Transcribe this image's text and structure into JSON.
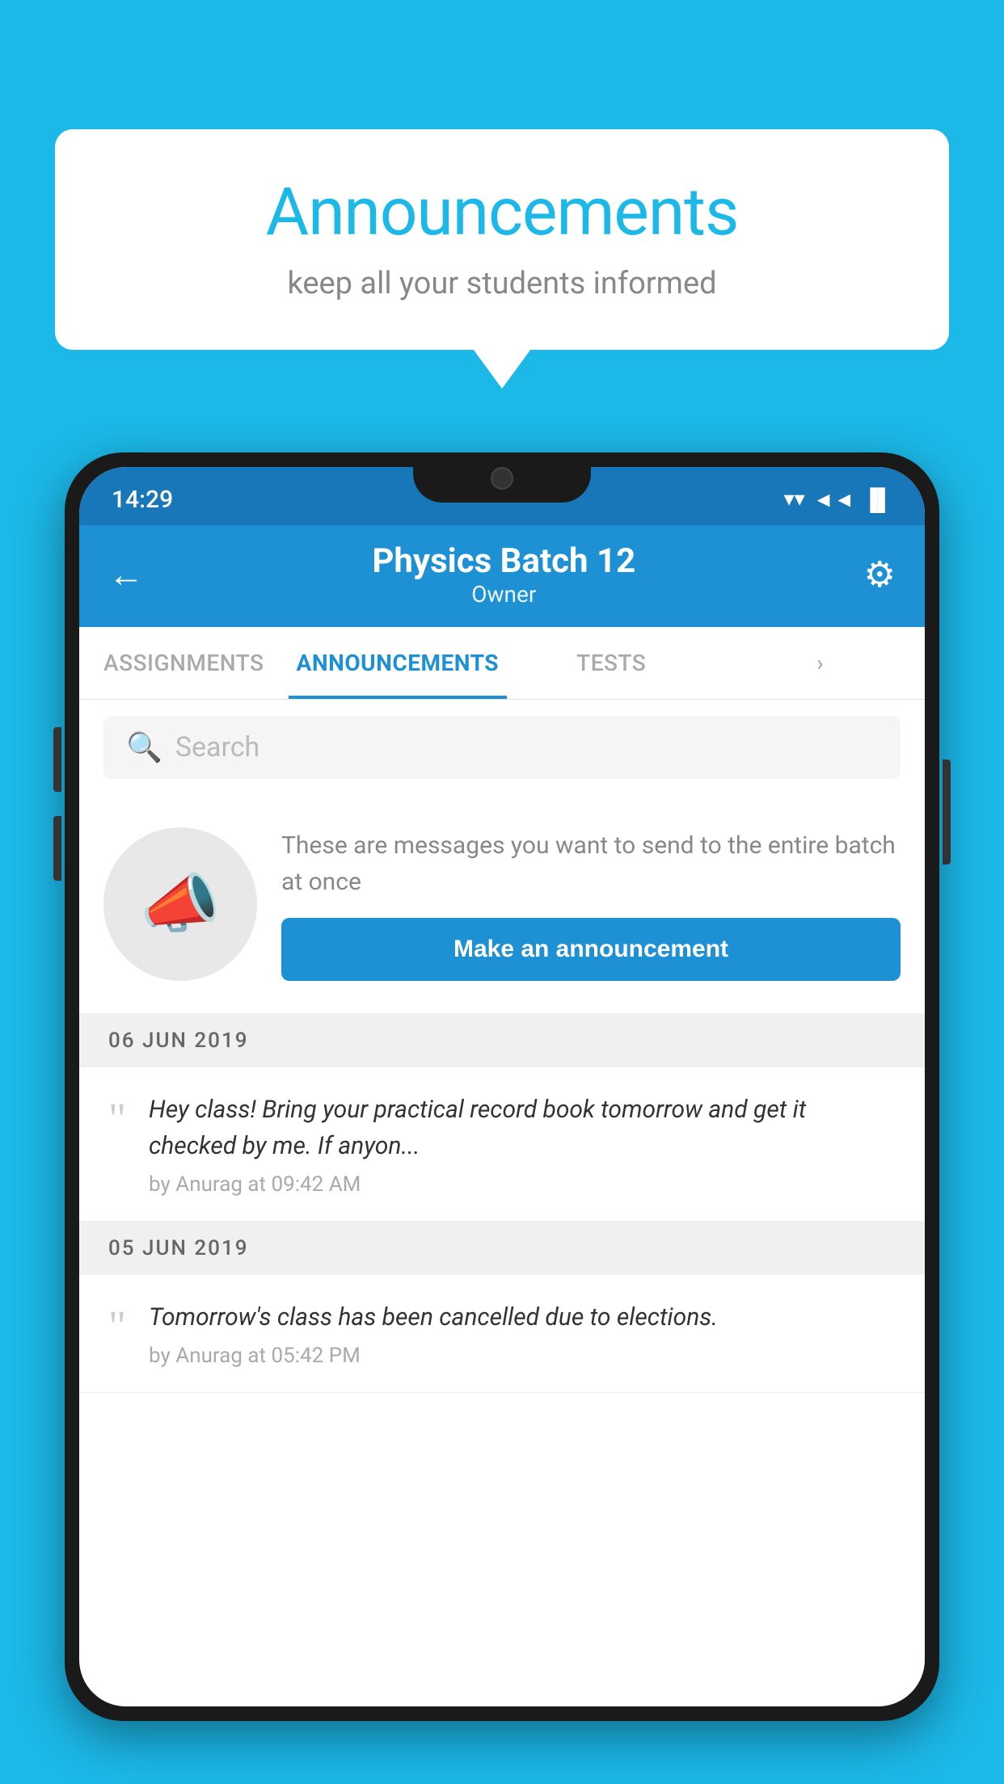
{
  "background_color": "#1cb8e8",
  "speech_bubble": {
    "title": "Announcements",
    "subtitle": "keep all your students informed"
  },
  "phone": {
    "status_bar": {
      "time": "14:29",
      "icons": [
        "▼",
        "◄",
        "▐"
      ]
    },
    "header": {
      "back_label": "←",
      "title": "Physics Batch 12",
      "subtitle": "Owner",
      "settings_icon": "⚙"
    },
    "tabs": [
      {
        "label": "ASSIGNMENTS",
        "active": false
      },
      {
        "label": "ANNOUNCEMENTS",
        "active": true
      },
      {
        "label": "TESTS",
        "active": false
      },
      {
        "label": "...",
        "active": false
      }
    ],
    "search": {
      "placeholder": "Search"
    },
    "announcement_intro": {
      "description": "These are messages you want to send to the entire batch at once",
      "button_label": "Make an announcement"
    },
    "announcements": [
      {
        "date": "06  JUN  2019",
        "message": "Hey class! Bring your practical record book tomorrow and get it checked by me. If anyon...",
        "meta": "by Anurag at 09:42 AM"
      },
      {
        "date": "05  JUN  2019",
        "message": "Tomorrow's class has been cancelled due to elections.",
        "meta": "by Anurag at 05:42 PM"
      }
    ]
  }
}
